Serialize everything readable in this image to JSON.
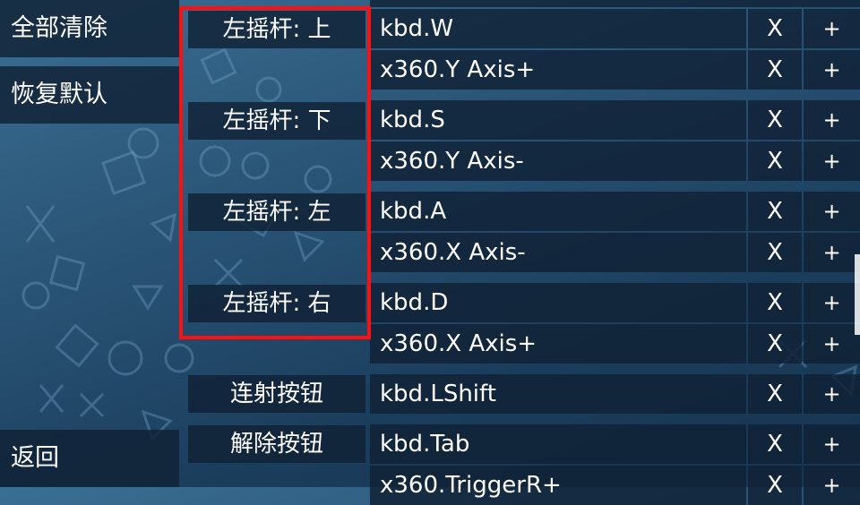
{
  "sidebar": {
    "clear_all": "全部清除",
    "restore_default": "恢复默认",
    "back": "返回"
  },
  "mappings": {
    "delete_label": "X",
    "add_label": "+",
    "groups": [
      {
        "label": "左摇杆: 上",
        "bindings": [
          "kbd.W",
          "x360.Y Axis+"
        ]
      },
      {
        "label": "左摇杆: 下",
        "bindings": [
          "kbd.S",
          "x360.Y Axis-"
        ]
      },
      {
        "label": "左摇杆: 左",
        "bindings": [
          "kbd.A",
          "x360.X Axis-"
        ]
      },
      {
        "label": "左摇杆: 右",
        "bindings": [
          "kbd.D",
          "x360.X Axis+"
        ]
      },
      {
        "label": "连射按钮",
        "bindings": [
          "kbd.LShift"
        ]
      },
      {
        "label": "解除按钮",
        "bindings": [
          "kbd.Tab",
          "x360.TriggerR+"
        ]
      }
    ]
  },
  "highlight_color": "#ff1010"
}
